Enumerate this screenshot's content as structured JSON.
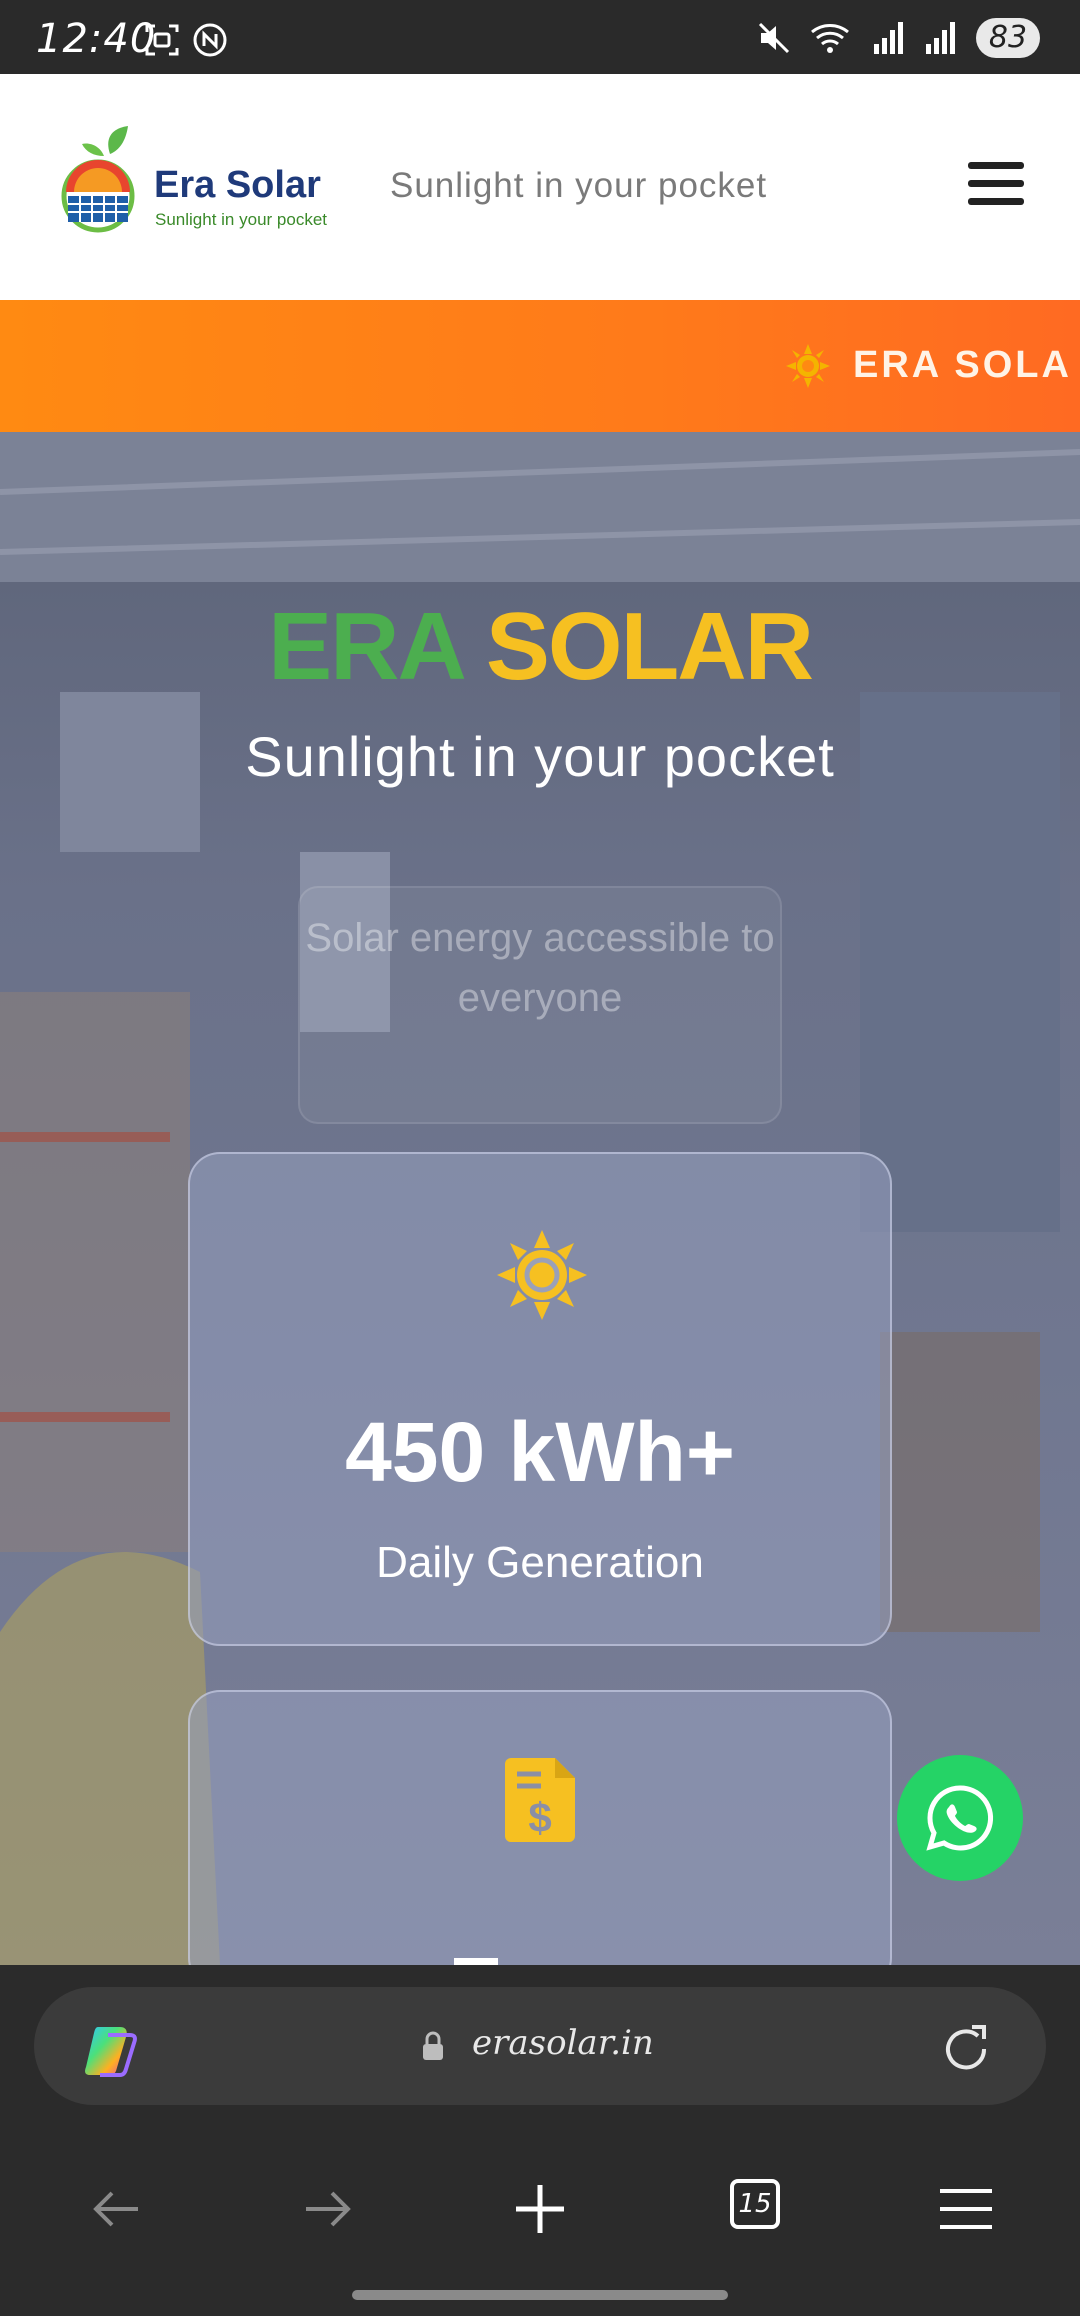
{
  "status_bar": {
    "time": "12:40",
    "battery": "83"
  },
  "header": {
    "logo_name": "Era Solar",
    "logo_tagline": "Sunlight in your pocket",
    "tagline": "Sunlight in your pocket"
  },
  "marquee": {
    "text": "ERA SOLA"
  },
  "hero": {
    "title_part1": "ERA",
    "title_part2": "SOLAR",
    "subtitle": "Sunlight in your pocket",
    "mission": "Solar energy accessible to everyone",
    "stats": [
      {
        "icon": "sun-icon",
        "value": "450 kWh+",
        "label": "Daily Generation"
      },
      {
        "icon": "invoice-dollar-icon"
      }
    ]
  },
  "browser": {
    "url": "erasolar.in",
    "tab_count": "15"
  },
  "colors": {
    "accent_orange": "#ff7a1a",
    "brand_green": "#4cae4f",
    "brand_yellow": "#f6c021",
    "whatsapp_green": "#25d366"
  }
}
